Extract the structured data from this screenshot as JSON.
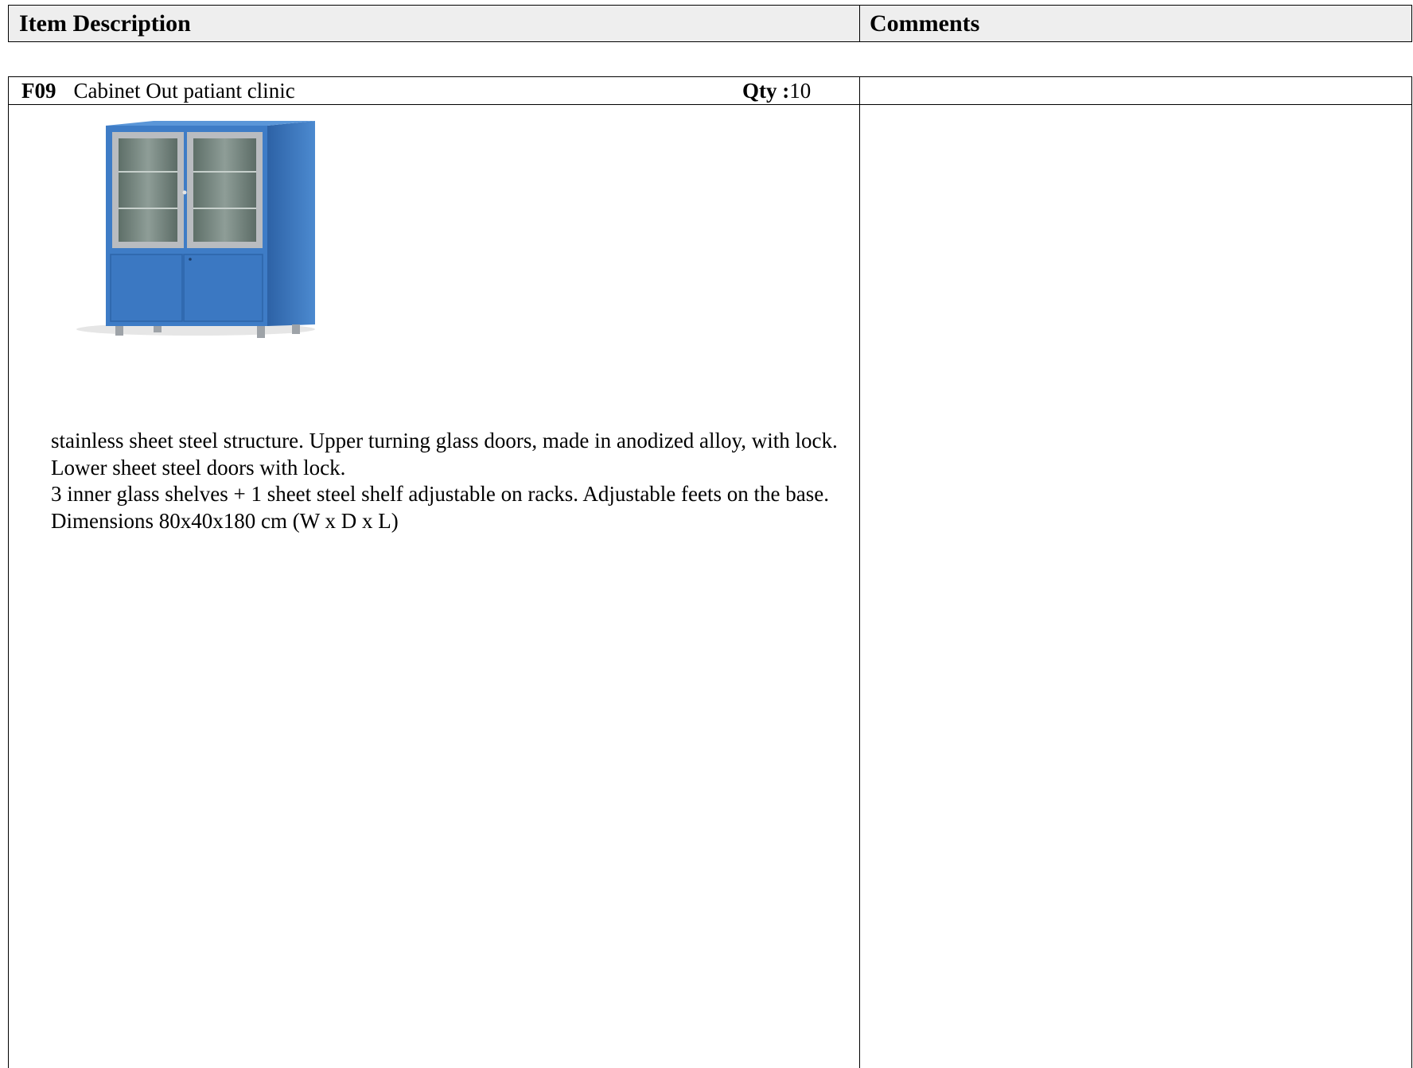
{
  "header": {
    "item_description_label": "Item Description",
    "comments_label": "Comments"
  },
  "item": {
    "code": "F09",
    "name": "Cabinet Out patiant clinic",
    "qty_label": "Qty :",
    "qty_value": "10",
    "comments": "",
    "description_lines": [
      "stainless sheet steel structure. Upper turning glass doors, made in anodized alloy, with lock.",
      "Lower sheet steel doors with lock.",
      "3 inner glass shelves + 1 sheet steel shelf adjustable on racks. Adjustable feets on the base.",
      "Dimensions 80x40x180 cm (W x D x L)"
    ],
    "image": {
      "subject": "blue-medical-cabinet",
      "body_color": "#3e7cc6",
      "body_dark_color": "#2f66ad",
      "frame_color": "#b9bcc0",
      "glass_color": "#6f7f78"
    }
  }
}
